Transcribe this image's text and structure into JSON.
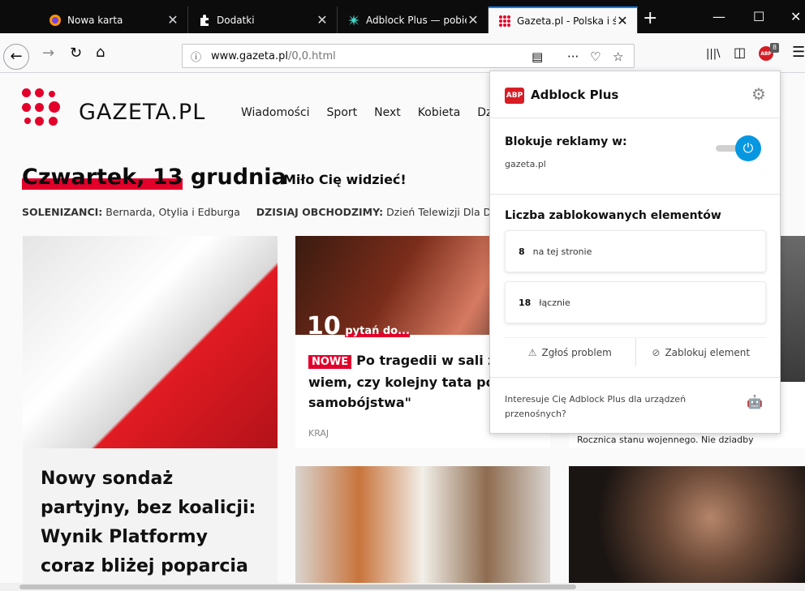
{
  "tabs": [
    {
      "label": "Nowa karta",
      "icon": "firefox-icon",
      "selected": false
    },
    {
      "label": "Dodatki",
      "icon": "puzzle-icon",
      "selected": false
    },
    {
      "label": "Adblock Plus — pobie",
      "icon": "abp-tab-icon",
      "selected": false
    },
    {
      "label": "Gazeta.pl - Polska i św",
      "icon": "gazeta-tab-icon",
      "selected": true
    }
  ],
  "tab_close": "✕",
  "new_tab": "+",
  "window": {
    "minimize": "—",
    "maximize": "☐",
    "close": "✕"
  },
  "navbar": {
    "back": "←",
    "forward": "→",
    "reload": "↻",
    "home": "⌂",
    "url_host": "www.gazeta.pl",
    "url_path": "/0,0.html",
    "info": "ⓘ",
    "reader": "▤",
    "more": "···",
    "pocket": "♡",
    "bookmark": "☆",
    "library": "|||\\",
    "sidebar": "◫",
    "menu": "☰",
    "abp_button": "ABP",
    "abp_badge": "8"
  },
  "site": {
    "name": "GAZETA.PL",
    "nav": [
      "Wiadomości",
      "Sport",
      "Next",
      "Kobieta",
      "Dzie"
    ],
    "date_prefix": "Czwartek, 13",
    "date_suffix": "grudnia",
    "greeting": "Miło Cię widzieć!",
    "names_label": "SOLENIZANCI:",
    "names_value": "Bernarda, Otylia i Edburga",
    "today_label": "DZISIAJ OBCHODZIMY:",
    "today_value": "Dzień Telewizji Dla Dzi"
  },
  "cards": {
    "card1_title": "Nowy sondaż partyjny, bez koalicji: Wynik Platformy coraz bliżej poparcia",
    "card2_overlay_big": "10",
    "card2_overlay_small": "pytań do...",
    "card2_badge": "NOWE",
    "card2_title": "Po tragedii w sali za \"Nie wiem, czy kolejny tata popełni samobójstwa\"",
    "card2_category": "KRAJ",
    "card4_text": "Rocznica stanu wojennego. Nie dziadby"
  },
  "abp": {
    "logo": "ABP",
    "title": "Adblock Plus",
    "gear": "⚙",
    "block_label": "Blokuje reklamy w:",
    "domain": "gazeta.pl",
    "toggle_icon": "⏻",
    "count_label": "Liczba zablokowanych elementów",
    "page_count": "8",
    "page_count_label": "na tej stronie",
    "total_count": "18",
    "total_count_label": "łącznie",
    "report_icon": "⚠",
    "report_label": "Zgłoś problem",
    "block_icon": "⊘",
    "block_element_label": "Zablokuj element",
    "mobile_text": "Interesuje Cię Adblock Plus dla urządzeń przenośnych?",
    "apple_icon": "",
    "android_icon": "🤖"
  },
  "colors": {
    "accent": "#0a84ff",
    "brand_red": "#e3002b",
    "abp_red": "#d71d24",
    "toggle_blue": "#0797e1"
  }
}
